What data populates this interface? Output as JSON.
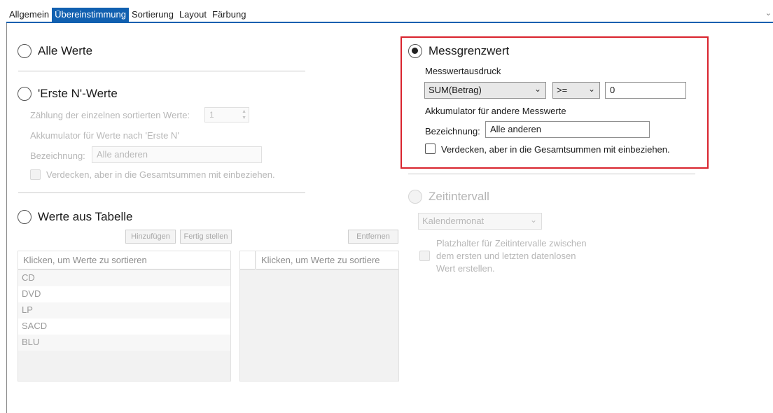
{
  "tabs": [
    {
      "label": "Allgemein",
      "active": false
    },
    {
      "label": "Übereinstimmung",
      "active": true
    },
    {
      "label": "Sortierung",
      "active": false
    },
    {
      "label": "Layout",
      "active": false
    },
    {
      "label": "Färbung",
      "active": false
    }
  ],
  "tab_chevron": "⌄",
  "all_values": {
    "label": "Alle Werte",
    "selected": false
  },
  "first_n": {
    "label": "'Erste N'-Werte",
    "selected": false,
    "count_label": "Zählung der einzelnen sortierten Werte:",
    "count_value": "1",
    "accumulator_label": "Akkumulator für Werte nach 'Erste N'",
    "name_label": "Bezeichnung:",
    "name_value": "Alle anderen",
    "hide_label": "Verdecken, aber in die Gesamtsummen mit einbeziehen."
  },
  "from_table": {
    "label": "Werte aus Tabelle",
    "selected": false,
    "add_button": "Hinzufügen",
    "finish_button": "Fertig stellen",
    "remove_button": "Entfernen",
    "left_list_header": "Klicken, um Werte zu sortieren",
    "left_list_items": [
      "CD",
      "DVD",
      "LP",
      "SACD",
      "BLU"
    ],
    "right_list_header": "Klicken, um Werte zu sortiere"
  },
  "measure_limit": {
    "label": "Messgrenzwert",
    "selected": true,
    "expression_label": "Messwertausdruck",
    "expression_value": "SUM(Betrag)",
    "operator_value": ">=",
    "threshold_value": "0",
    "accumulator_label": "Akkumulator für andere Messwerte",
    "name_label": "Bezeichnung:",
    "name_value": "Alle anderen",
    "hide_label": "Verdecken, aber in die Gesamtsummen mit einbeziehen.",
    "highlight_color": "#d9232d"
  },
  "time_interval": {
    "label": "Zeitintervall",
    "selected": false,
    "interval_value": "Kalendermonat",
    "placeholder_line1": "Platzhalter für Zeitintervalle zwischen",
    "placeholder_line2": "dem ersten und letzten datenlosen",
    "placeholder_line3": "Wert erstellen."
  },
  "colors": {
    "accent": "#1160b0",
    "disabled_text": "#b7b7b7"
  }
}
